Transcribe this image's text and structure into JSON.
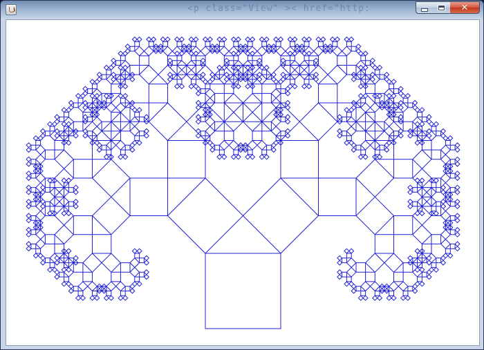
{
  "window": {
    "title": "",
    "background_title_glimpse": "<p class=\"View\" >< href=\"http:",
    "controls": {
      "minimize_icon": "minimize-icon",
      "maximize_icon": "maximize-icon",
      "close_icon": "close-icon",
      "close_glyph": "✕"
    }
  },
  "canvas": {
    "background": "#ffffff",
    "stroke_color": "#1f1fd6",
    "figure": "pythagoras-tree",
    "recursion_depth": 10,
    "branch_angle_degrees": 45
  }
}
